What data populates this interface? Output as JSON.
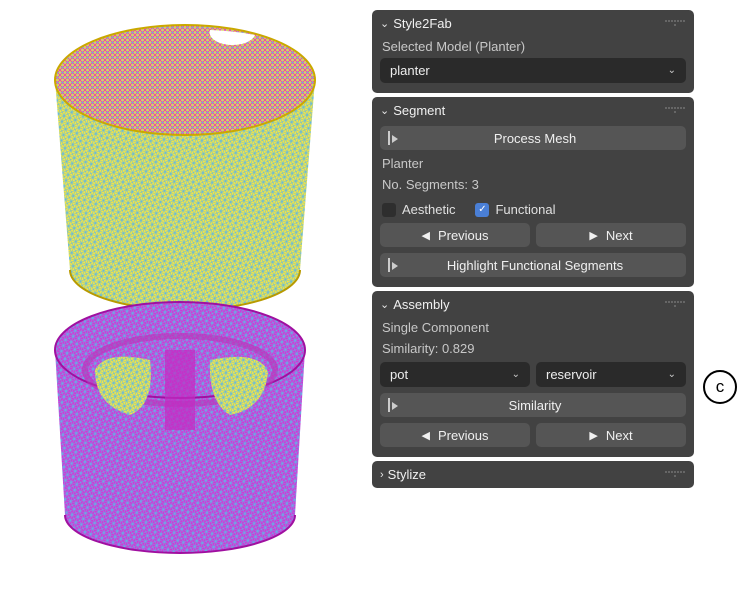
{
  "viewport": {
    "model_top_color": "#f5e642",
    "model_bottom_color": "#d633d6",
    "wire_color": "#5fb7e6"
  },
  "style2fab": {
    "title": "Style2Fab",
    "selected_model_label": "Selected Model (Planter)",
    "selected_model_value": "planter"
  },
  "segment": {
    "title": "Segment",
    "process_btn": "Process Mesh",
    "model_name": "Planter",
    "segments_label": "No. Segments: 3",
    "aesthetic_label": "Aesthetic",
    "aesthetic_checked": false,
    "functional_label": "Functional",
    "functional_checked": true,
    "prev_label": "Previous",
    "next_label": "Next",
    "highlight_label": "Highlight Functional Segments"
  },
  "assembly": {
    "title": "Assembly",
    "component_label": "Single Component",
    "similarity_label": "Similarity: 0.829",
    "select_a": "pot",
    "select_b": "reservoir",
    "similarity_btn": "Similarity",
    "prev_label": "Previous",
    "next_label": "Next"
  },
  "stylize": {
    "title": "Stylize"
  },
  "figure_label": "c"
}
